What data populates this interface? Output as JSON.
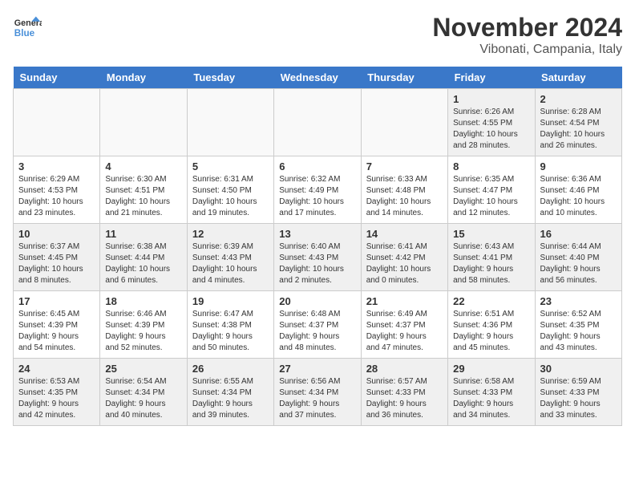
{
  "logo": {
    "line1": "General",
    "line2": "Blue"
  },
  "header": {
    "month": "November 2024",
    "location": "Vibonati, Campania, Italy"
  },
  "weekdays": [
    "Sunday",
    "Monday",
    "Tuesday",
    "Wednesday",
    "Thursday",
    "Friday",
    "Saturday"
  ],
  "weeks": [
    [
      {
        "day": "",
        "info": ""
      },
      {
        "day": "",
        "info": ""
      },
      {
        "day": "",
        "info": ""
      },
      {
        "day": "",
        "info": ""
      },
      {
        "day": "",
        "info": ""
      },
      {
        "day": "1",
        "info": "Sunrise: 6:26 AM\nSunset: 4:55 PM\nDaylight: 10 hours\nand 28 minutes."
      },
      {
        "day": "2",
        "info": "Sunrise: 6:28 AM\nSunset: 4:54 PM\nDaylight: 10 hours\nand 26 minutes."
      }
    ],
    [
      {
        "day": "3",
        "info": "Sunrise: 6:29 AM\nSunset: 4:53 PM\nDaylight: 10 hours\nand 23 minutes."
      },
      {
        "day": "4",
        "info": "Sunrise: 6:30 AM\nSunset: 4:51 PM\nDaylight: 10 hours\nand 21 minutes."
      },
      {
        "day": "5",
        "info": "Sunrise: 6:31 AM\nSunset: 4:50 PM\nDaylight: 10 hours\nand 19 minutes."
      },
      {
        "day": "6",
        "info": "Sunrise: 6:32 AM\nSunset: 4:49 PM\nDaylight: 10 hours\nand 17 minutes."
      },
      {
        "day": "7",
        "info": "Sunrise: 6:33 AM\nSunset: 4:48 PM\nDaylight: 10 hours\nand 14 minutes."
      },
      {
        "day": "8",
        "info": "Sunrise: 6:35 AM\nSunset: 4:47 PM\nDaylight: 10 hours\nand 12 minutes."
      },
      {
        "day": "9",
        "info": "Sunrise: 6:36 AM\nSunset: 4:46 PM\nDaylight: 10 hours\nand 10 minutes."
      }
    ],
    [
      {
        "day": "10",
        "info": "Sunrise: 6:37 AM\nSunset: 4:45 PM\nDaylight: 10 hours\nand 8 minutes."
      },
      {
        "day": "11",
        "info": "Sunrise: 6:38 AM\nSunset: 4:44 PM\nDaylight: 10 hours\nand 6 minutes."
      },
      {
        "day": "12",
        "info": "Sunrise: 6:39 AM\nSunset: 4:43 PM\nDaylight: 10 hours\nand 4 minutes."
      },
      {
        "day": "13",
        "info": "Sunrise: 6:40 AM\nSunset: 4:43 PM\nDaylight: 10 hours\nand 2 minutes."
      },
      {
        "day": "14",
        "info": "Sunrise: 6:41 AM\nSunset: 4:42 PM\nDaylight: 10 hours\nand 0 minutes."
      },
      {
        "day": "15",
        "info": "Sunrise: 6:43 AM\nSunset: 4:41 PM\nDaylight: 9 hours\nand 58 minutes."
      },
      {
        "day": "16",
        "info": "Sunrise: 6:44 AM\nSunset: 4:40 PM\nDaylight: 9 hours\nand 56 minutes."
      }
    ],
    [
      {
        "day": "17",
        "info": "Sunrise: 6:45 AM\nSunset: 4:39 PM\nDaylight: 9 hours\nand 54 minutes."
      },
      {
        "day": "18",
        "info": "Sunrise: 6:46 AM\nSunset: 4:39 PM\nDaylight: 9 hours\nand 52 minutes."
      },
      {
        "day": "19",
        "info": "Sunrise: 6:47 AM\nSunset: 4:38 PM\nDaylight: 9 hours\nand 50 minutes."
      },
      {
        "day": "20",
        "info": "Sunrise: 6:48 AM\nSunset: 4:37 PM\nDaylight: 9 hours\nand 48 minutes."
      },
      {
        "day": "21",
        "info": "Sunrise: 6:49 AM\nSunset: 4:37 PM\nDaylight: 9 hours\nand 47 minutes."
      },
      {
        "day": "22",
        "info": "Sunrise: 6:51 AM\nSunset: 4:36 PM\nDaylight: 9 hours\nand 45 minutes."
      },
      {
        "day": "23",
        "info": "Sunrise: 6:52 AM\nSunset: 4:35 PM\nDaylight: 9 hours\nand 43 minutes."
      }
    ],
    [
      {
        "day": "24",
        "info": "Sunrise: 6:53 AM\nSunset: 4:35 PM\nDaylight: 9 hours\nand 42 minutes."
      },
      {
        "day": "25",
        "info": "Sunrise: 6:54 AM\nSunset: 4:34 PM\nDaylight: 9 hours\nand 40 minutes."
      },
      {
        "day": "26",
        "info": "Sunrise: 6:55 AM\nSunset: 4:34 PM\nDaylight: 9 hours\nand 39 minutes."
      },
      {
        "day": "27",
        "info": "Sunrise: 6:56 AM\nSunset: 4:34 PM\nDaylight: 9 hours\nand 37 minutes."
      },
      {
        "day": "28",
        "info": "Sunrise: 6:57 AM\nSunset: 4:33 PM\nDaylight: 9 hours\nand 36 minutes."
      },
      {
        "day": "29",
        "info": "Sunrise: 6:58 AM\nSunset: 4:33 PM\nDaylight: 9 hours\nand 34 minutes."
      },
      {
        "day": "30",
        "info": "Sunrise: 6:59 AM\nSunset: 4:33 PM\nDaylight: 9 hours\nand 33 minutes."
      }
    ]
  ]
}
